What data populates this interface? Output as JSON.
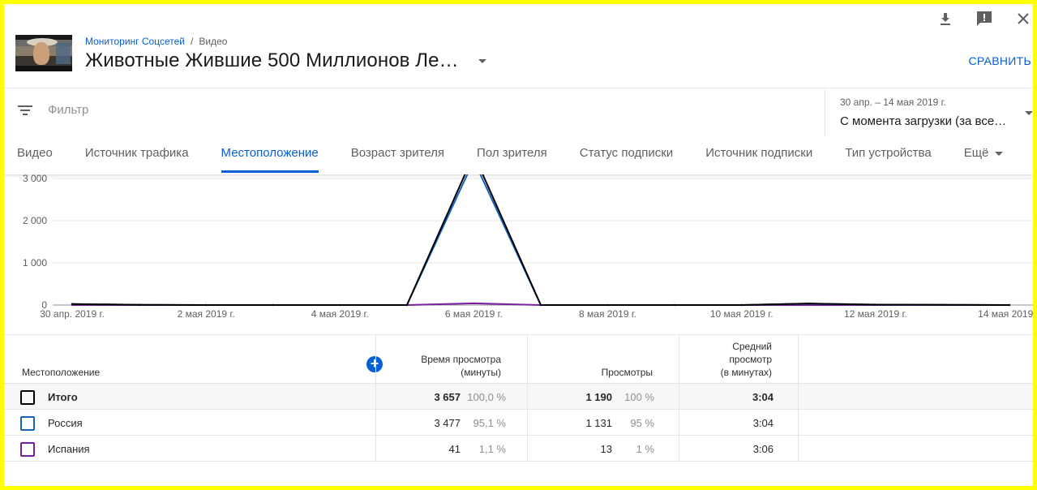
{
  "breadcrumb": {
    "channel": "Мониторинг Соцсетей",
    "sep": "/",
    "section": "Видео"
  },
  "title": "Животные Жившие 500 Миллионов Ле…",
  "compare_label": "СРАВНИТЬ",
  "filter": {
    "placeholder": "Фильтр"
  },
  "date_range": {
    "range": "30 апр. – 14 мая 2019 г.",
    "label": "С момента загрузки (за все…"
  },
  "tabs": [
    "Видео",
    "Источник трафика",
    "Местоположение",
    "Возраст зрителя",
    "Пол зрителя",
    "Статус подписки",
    "Источник подписки",
    "Тип устройства",
    "Ещё"
  ],
  "active_tab": "Местоположение",
  "icons": {
    "download": "download-icon",
    "feedback": "feedback-icon",
    "close": "close-icon",
    "filter": "filter-icon",
    "add": "plus-icon"
  },
  "colors": {
    "accent": "#065fd4",
    "total": "#000000",
    "russia": "#1565c0",
    "spain": "#7b1fa2"
  },
  "chart_data": {
    "type": "line",
    "x": [
      "30 апр. 2019 г.",
      "1 мая",
      "2 мая 2019 г.",
      "3 мая",
      "4 мая 2019 г.",
      "5 мая",
      "6 мая 2019 г.",
      "7 мая",
      "8 мая 2019 г.",
      "9 мая",
      "10 мая 2019 г.",
      "11 мая",
      "12 мая 2019 г.",
      "13 мая",
      "14 мая 2019 г."
    ],
    "x_ticks": [
      "30 апр. 2019 г.",
      "2 мая 2019 г.",
      "4 мая 2019 г.",
      "6 мая 2019 г.",
      "8 мая 2019 г.",
      "10 мая 2019 г.",
      "12 мая 2019 г.",
      "14 мая 2019 г."
    ],
    "y_ticks": [
      "0",
      "1 000",
      "2 000",
      "3 000"
    ],
    "ylim": [
      0,
      3000
    ],
    "grid": true,
    "series": [
      {
        "name": "Итого",
        "color": "#000000",
        "values": [
          25,
          5,
          0,
          0,
          0,
          0,
          3570,
          0,
          0,
          0,
          0,
          35,
          10,
          5,
          0
        ]
      },
      {
        "name": "Россия",
        "color": "#1565c0",
        "values": [
          22,
          4,
          0,
          0,
          0,
          0,
          3430,
          0,
          0,
          0,
          0,
          33,
          8,
          4,
          0
        ]
      },
      {
        "name": "Испания",
        "color": "#7b1fa2",
        "values": [
          0,
          0,
          0,
          0,
          0,
          0,
          40,
          0,
          0,
          0,
          0,
          0,
          0,
          0,
          0
        ]
      }
    ]
  },
  "table": {
    "headers": {
      "location": "Местоположение",
      "watch_time": [
        "Время просмотра",
        "(минуты)"
      ],
      "views": "Просмотры",
      "avg": [
        "Средний",
        "просмотр",
        "(в минутах)"
      ]
    },
    "rows": [
      {
        "name": "Итого",
        "color": "#000000",
        "watch": "3 657",
        "watch_pct": "100,0 %",
        "views": "1 190",
        "views_pct": "100 %",
        "avg": "3:04"
      },
      {
        "name": "Россия",
        "color": "#1565c0",
        "watch": "3 477",
        "watch_pct": "95,1 %",
        "views": "1 131",
        "views_pct": "95 %",
        "avg": "3:04"
      },
      {
        "name": "Испания",
        "color": "#7b1fa2",
        "watch": "41",
        "watch_pct": "1,1 %",
        "views": "13",
        "views_pct": "1 %",
        "avg": "3:06"
      }
    ]
  }
}
